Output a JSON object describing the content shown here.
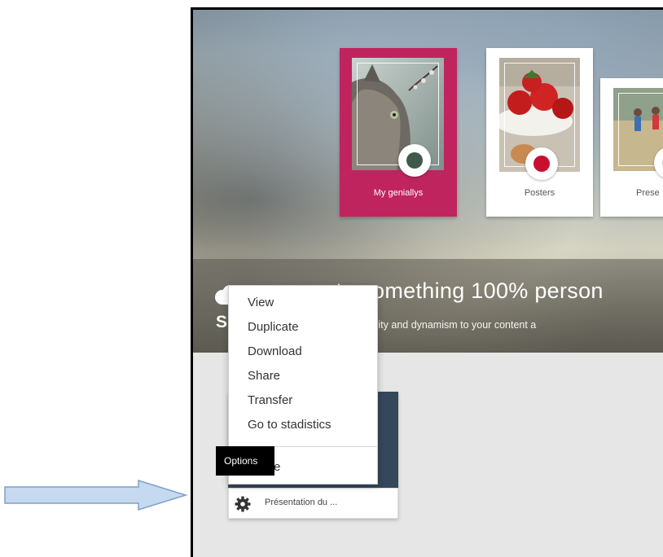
{
  "categories": [
    {
      "label": "My geniallys",
      "active": true,
      "dot_color": "#3f5a4a"
    },
    {
      "label": "Posters",
      "active": false,
      "dot_color": "#c8102e"
    },
    {
      "label": "Prese",
      "active": false,
      "dot_color": "#cccccc"
    }
  ],
  "hero": {
    "title": "ate something 100% person",
    "subtitle": "de interactivity and dynamism to your content a",
    "partial_char": "S"
  },
  "context_menu": {
    "items": [
      "View",
      "Duplicate",
      "Download",
      "Share",
      "Transfer",
      "Go to stadistics"
    ],
    "last_item_partial": "te"
  },
  "tooltip": {
    "text": "Options"
  },
  "creation": {
    "name": "Présentation du ..."
  },
  "colors": {
    "accent": "#c0245e",
    "card_dark": "#35475a",
    "arrow_fill": "#c5d9f1",
    "arrow_stroke": "#7f9fc6"
  }
}
